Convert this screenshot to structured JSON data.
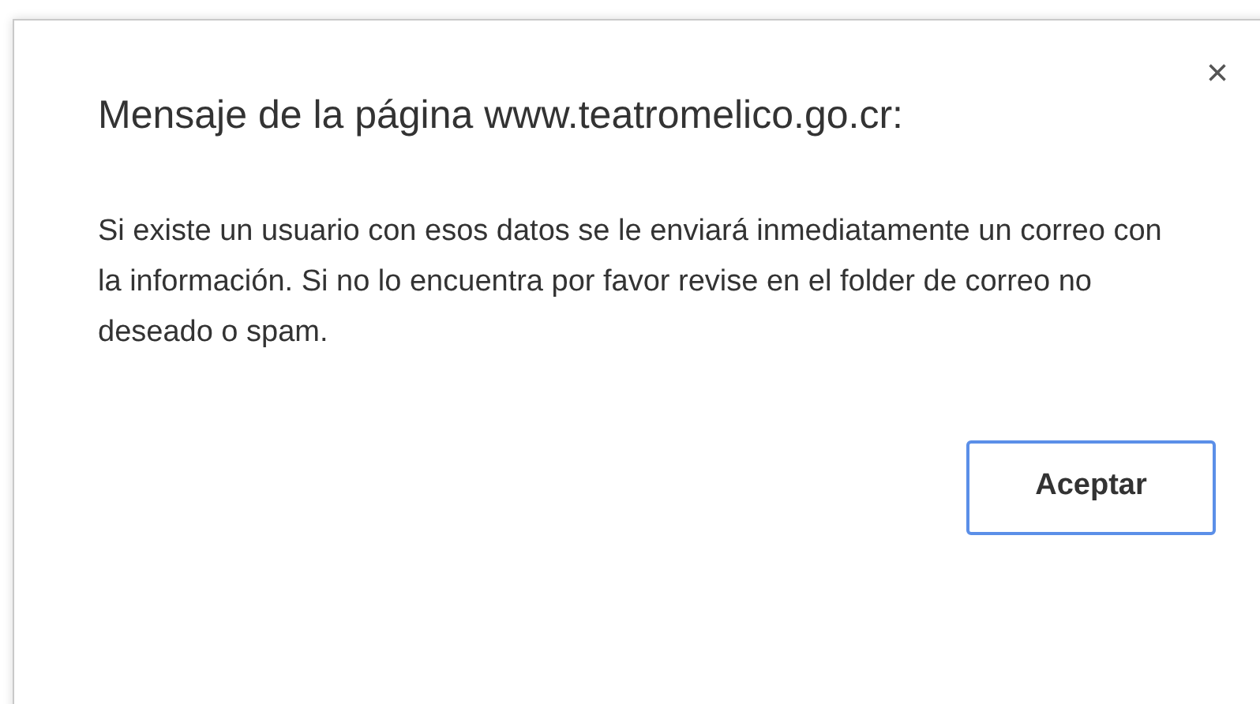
{
  "dialog": {
    "title": "Mensaje de la página www.teatromelico.go.cr:",
    "close": "×",
    "message": "Si existe un usuario con esos datos se le enviará inmediatamente un correo con la información. Si no lo encuentra por favor revise en el folder de correo no deseado o spam.",
    "buttons": [
      {
        "label": "Aceptar",
        "selected": true
      }
    ]
  }
}
